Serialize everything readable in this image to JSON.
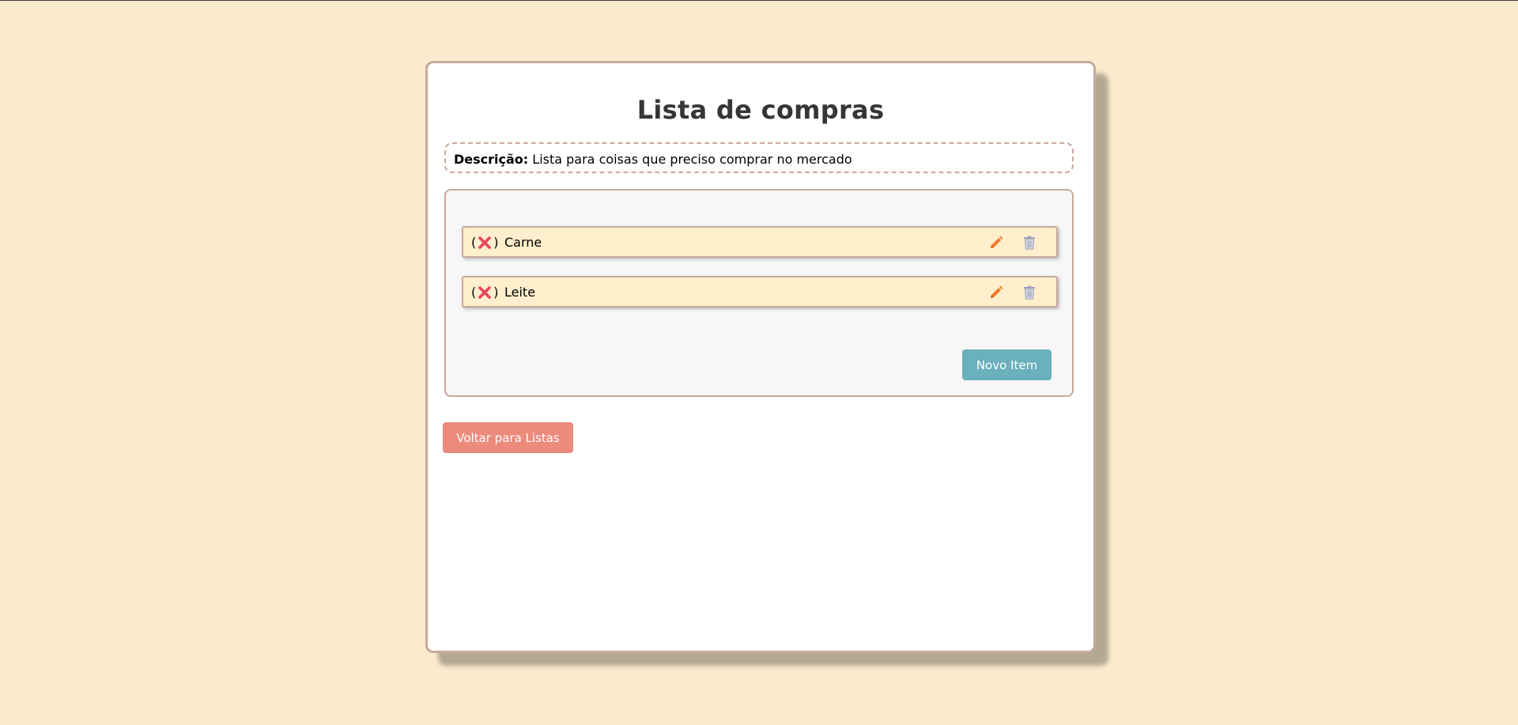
{
  "page": {
    "title": "Lista de compras"
  },
  "description": {
    "label": "Descrição:",
    "text": " Lista para coisas que preciso comprar no mercado"
  },
  "items": [
    {
      "name": "Carne",
      "status_open": "(",
      "status_close": ")",
      "status_icon": "red-x-icon"
    },
    {
      "name": "Leite",
      "status_open": "(",
      "status_close": ")",
      "status_icon": "red-x-icon"
    }
  ],
  "actions": {
    "new_item_label": "Novo Item",
    "back_label": "Voltar para Listas"
  },
  "colors": {
    "background": "#faebcc",
    "card_border": "#c8a89c",
    "item_background": "#ffefcc",
    "new_item_button": "#6ab0bd",
    "back_button": "#ec8a7c",
    "x_icon": "#e8435b",
    "edit_icon": "#f07a2e",
    "delete_icon": "#9aa0b8"
  }
}
